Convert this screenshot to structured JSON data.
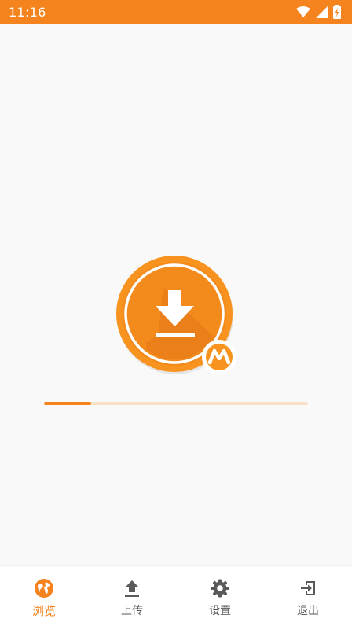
{
  "status_bar": {
    "time": "11:16",
    "icons": [
      "wifi-icon",
      "cellular-signal-icon",
      "battery-charging-icon"
    ]
  },
  "splash": {
    "logo_icon": "download-badge-icon",
    "progress_fraction": 0.18
  },
  "bottom_nav": {
    "items": [
      {
        "label": "浏览",
        "icon": "globe-icon",
        "active": true
      },
      {
        "label": "上传",
        "icon": "upload-icon",
        "active": false
      },
      {
        "label": "设置",
        "icon": "gear-icon",
        "active": false
      },
      {
        "label": "退出",
        "icon": "exit-icon",
        "active": false
      }
    ]
  },
  "colors": {
    "accent": "#f5841f",
    "progress_track": "#fbe0c8",
    "background": "#f9f9f9",
    "inactive": "#555555"
  }
}
